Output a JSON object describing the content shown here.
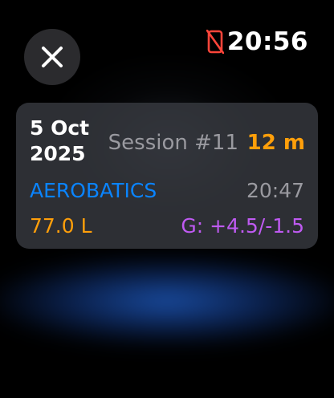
{
  "status_bar": {
    "time": "20:56",
    "indicator_icon": "phone-disconnected-icon",
    "indicator_color": "#ff453a"
  },
  "close_button": {
    "icon": "close-icon"
  },
  "session_card": {
    "date": "5 Oct 2025",
    "session_label": "Session #11",
    "duration": "12 m",
    "category": "AEROBATICS",
    "start_time": "20:47",
    "fuel": "77.0 L",
    "g_force": "G: +4.5/-1.5"
  },
  "colors": {
    "accent_orange": "#ff9f0a",
    "accent_blue": "#0a84ff",
    "accent_purple": "#bf5af2",
    "secondary_text": "#9a9aa0"
  }
}
